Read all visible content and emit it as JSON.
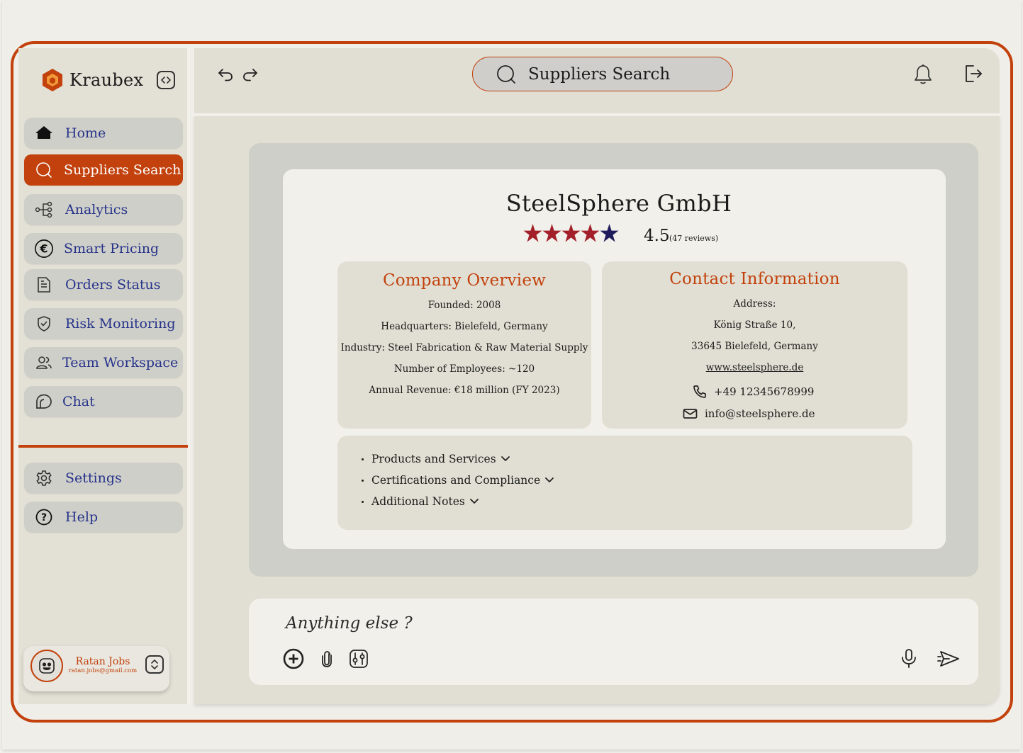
{
  "app": {
    "brand_name": "Kraubex",
    "accent_color": "#c2410c",
    "nav_text_color": "#26338a"
  },
  "sidebar": {
    "items": [
      {
        "label": "Home",
        "icon": "home-icon"
      },
      {
        "label": "Suppliers Search",
        "icon": "search-icon",
        "active": true
      },
      {
        "label": "Analytics",
        "icon": "analytics-tree-icon"
      },
      {
        "label": "Smart Pricing",
        "icon": "euro-icon"
      },
      {
        "label": "Orders Status",
        "icon": "document-icon"
      },
      {
        "label": "Risk Monitoring",
        "icon": "shield-check-icon"
      },
      {
        "label": "Team Workspace",
        "icon": "users-icon"
      },
      {
        "label": "Chat",
        "icon": "chat-bubble-icon"
      }
    ],
    "bottom_items": [
      {
        "label": "Settings",
        "icon": "gear-icon"
      },
      {
        "label": "Help",
        "icon": "help-circle-icon"
      }
    ],
    "profile": {
      "name": "Ratan Jobs",
      "email": "ratan.jobs@gmail.com"
    }
  },
  "topbar": {
    "search_label": "Suppliers Search"
  },
  "supplier": {
    "name": "SteelSphere GmbH",
    "rating": "4.5",
    "reviews": "(47 reviews)",
    "rating_value": 4.5,
    "stars_max": 5,
    "star_colors": {
      "filled": "#a3202a",
      "last": "#1e1b5c"
    },
    "overview": {
      "title": "Company Overview",
      "lines": [
        "Founded: 2008",
        "Headquarters: Bielefeld, Germany",
        "Industry: Steel Fabrication & Raw Material Supply",
        "Number of Employees: ~120",
        "Annual Revenue: €18 million (FY 2023)"
      ]
    },
    "contact": {
      "title": "Contact Information",
      "address_label": "Address:",
      "address_line1": "König Straße 10,",
      "address_line2": "33645 Bielefeld, Germany",
      "website": "www.steelsphere.de",
      "phone": "+49 12345678999",
      "email": "info@steelsphere.de"
    },
    "sections": [
      "Products and Services",
      "Certifications and Compliance",
      "Additional Notes"
    ]
  },
  "chat": {
    "placeholder": "Anything else ?"
  }
}
